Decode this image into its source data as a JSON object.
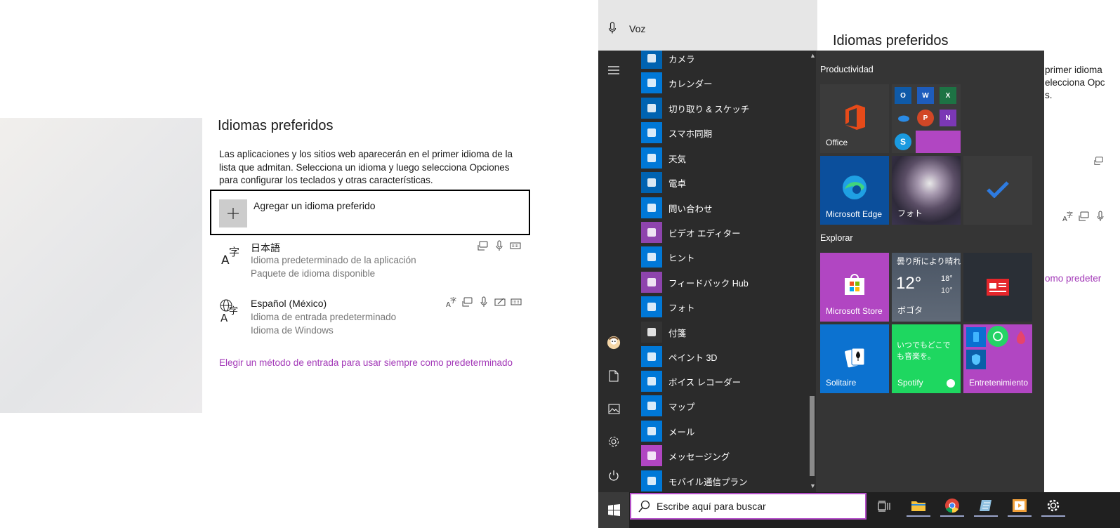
{
  "settings": {
    "title": "Idiomas preferidos",
    "description": "Las aplicaciones y los sitios web aparecerán en el primer idioma de la lista que admitan. Selecciona un idioma y luego selecciona Opciones para configurar los teclados y otras características.",
    "add_language_label": "Agregar un idioma preferido",
    "languages": [
      {
        "name": "日本語",
        "line1": "Idioma predeterminado de la aplicación",
        "line2": "Paquete de idioma disponible"
      },
      {
        "name": "Español (México)",
        "line1": "Idioma de entrada predeterminado",
        "line2": "Idioma de Windows"
      }
    ],
    "default_input_link": "Elegir un método de entrada para usar siempre como predeterminado",
    "link_color": "#a339b8"
  },
  "behind": {
    "voice_label": "Voz",
    "title": "Idiomas preferidos",
    "text_line1": "primer idioma",
    "text_line2": "elecciona Opc",
    "text_line3": "s.",
    "link_fragment": "omo predeter"
  },
  "start_menu": {
    "apps": [
      {
        "label": "カメラ",
        "icon": "camera-icon",
        "color": "#0063b1"
      },
      {
        "label": "カレンダー",
        "icon": "calendar-icon",
        "color": "#0078d7"
      },
      {
        "label": "切り取り & スケッチ",
        "icon": "snip-sketch-icon",
        "color": "#0063b1"
      },
      {
        "label": "スマホ同期",
        "icon": "phone-link-icon",
        "color": "#0078d7"
      },
      {
        "label": "天気",
        "icon": "weather-icon",
        "color": "#0078d7"
      },
      {
        "label": "電卓",
        "icon": "calculator-icon",
        "color": "#0063b1"
      },
      {
        "label": "問い合わせ",
        "icon": "help-icon",
        "color": "#0078d7"
      },
      {
        "label": "ビデオ エディター",
        "icon": "video-editor-icon",
        "color": "#8e44ad"
      },
      {
        "label": "ヒント",
        "icon": "tips-icon",
        "color": "#0078d7"
      },
      {
        "label": "フィードバック Hub",
        "icon": "feedback-icon",
        "color": "#8e44ad"
      },
      {
        "label": "フォト",
        "icon": "photos-icon",
        "color": "#0078d7"
      },
      {
        "label": "付箋",
        "icon": "sticky-notes-icon",
        "color": "#333333"
      },
      {
        "label": "ペイント 3D",
        "icon": "paint3d-icon",
        "color": "#0078d7"
      },
      {
        "label": "ボイス レコーダー",
        "icon": "voice-recorder-icon",
        "color": "#0078d7"
      },
      {
        "label": "マップ",
        "icon": "maps-icon",
        "color": "#0078d7"
      },
      {
        "label": "メール",
        "icon": "mail-icon",
        "color": "#0078d7"
      },
      {
        "label": "メッセージング",
        "icon": "messaging-icon",
        "color": "#b146c2"
      },
      {
        "label": "モバイル通信プラン",
        "icon": "mobile-plans-icon",
        "color": "#0078d7"
      }
    ],
    "groups": {
      "productivity": "Productividad",
      "explore": "Explorar"
    },
    "tiles": {
      "office": "Office",
      "edge": "Microsoft Edge",
      "photos": "フォト",
      "store": "Microsoft Store",
      "weather_condition": "曇り所により晴れ",
      "weather_temp": "12°",
      "weather_high": "18°",
      "weather_low": "10°",
      "weather_city": "ボゴタ",
      "solitaire": "Solitaire",
      "spotify_text": "いつでもどこでも音楽を。",
      "spotify": "Spotify",
      "entertainment": "Entretenimiento"
    }
  },
  "taskbar": {
    "search_placeholder": "Escribe aquí para buscar",
    "accent": "#b44ec8"
  }
}
